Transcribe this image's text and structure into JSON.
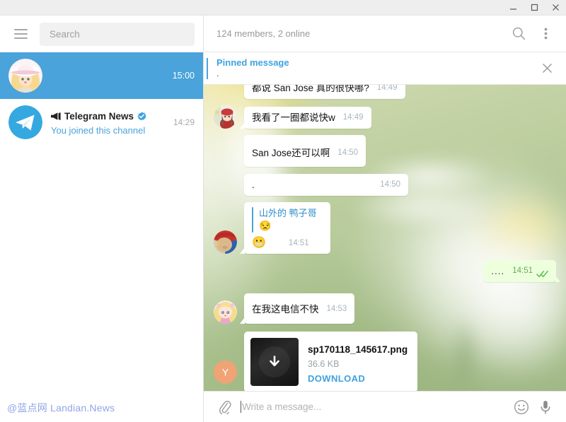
{
  "window": {
    "minimize_label": "Minimize",
    "maximize_label": "Maximize",
    "close_label": "Close"
  },
  "sidebar": {
    "menu_label": "Menu",
    "search": {
      "placeholder": "Search",
      "value": ""
    },
    "chats": [
      {
        "name": "",
        "preview": "",
        "time": "15:00",
        "selected": true,
        "avatar_type": "photo-anime-girl-hat",
        "is_channel": false,
        "verified": false
      },
      {
        "name": "Telegram News",
        "preview": "You joined this channel",
        "time": "14:29",
        "selected": false,
        "avatar_type": "telegram-logo",
        "is_channel": true,
        "verified": true
      }
    ],
    "watermark": "@蓝点网 Landian.News"
  },
  "chat_header": {
    "title": "",
    "subtitle": "124 members, 2 online",
    "search_label": "Search",
    "more_label": "More"
  },
  "pinned": {
    "title": "Pinned message",
    "text": ".",
    "close_label": "Close pinned message"
  },
  "messages": [
    {
      "kind": "text",
      "side": "in",
      "text": "都说 San Jose 真的很快哪?",
      "time": "14:49",
      "avatar": "none",
      "tail": false,
      "clipped_top": true
    },
    {
      "kind": "text",
      "side": "in",
      "text": "我看了一圈都说快w",
      "time": "14:49",
      "avatar": "photo-red-hood-girl",
      "tail": true
    },
    {
      "kind": "text",
      "side": "in",
      "text": "San Jose还可以啊",
      "time": "14:50",
      "avatar": "none",
      "tail": false
    },
    {
      "kind": "text",
      "side": "in",
      "text": ".",
      "time": "14:50",
      "avatar": "none",
      "tail": false
    },
    {
      "kind": "reply",
      "side": "in",
      "reply_name": "山外的 鸭子哥",
      "reply_snippet": "😒",
      "text": "😬",
      "time": "14:51",
      "avatar": "photo-red-cap-character",
      "tail": true
    },
    {
      "kind": "text",
      "side": "out",
      "text": "....",
      "time": "14:51",
      "tail": true,
      "read": true
    },
    {
      "kind": "text",
      "side": "in",
      "text": "在我这电信不快",
      "time": "14:53",
      "avatar": "photo-blonde-chibi",
      "tail": true
    },
    {
      "kind": "file",
      "side": "in",
      "file_name": "sp170118_145617.png",
      "file_size": "36.6 KB",
      "download_label": "DOWNLOAD",
      "avatar": "initial-Y",
      "avatar_initial": "Y",
      "avatar_color": "#f0a375",
      "tail": false
    }
  ],
  "composer": {
    "attach_label": "Attach file",
    "placeholder": "Write a message...",
    "value": "",
    "emoji_label": "Emoji",
    "voice_label": "Record voice message"
  },
  "colors": {
    "accent": "#4aa3da",
    "selected_row": "#4aa3da",
    "out_bubble": "#eeffde",
    "in_bubble": "#ffffff",
    "pinned_title": "#3fa2e0",
    "link": "#4aa3da",
    "watermark": "#8fa6e8",
    "check_green": "#5dc452"
  }
}
